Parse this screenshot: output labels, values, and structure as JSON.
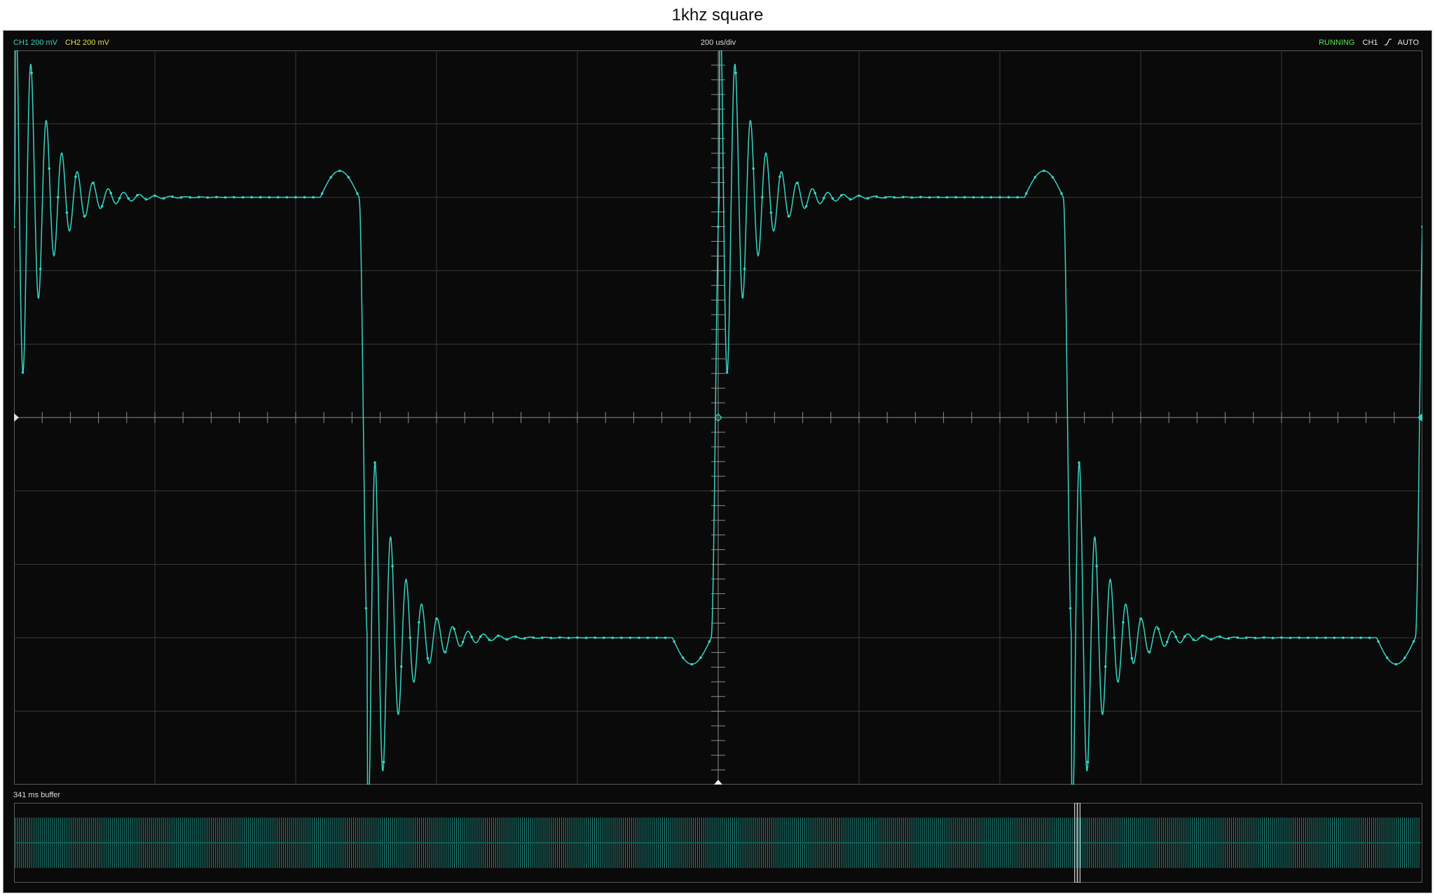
{
  "title": "1khz square",
  "status": {
    "ch1": "CH1 200 mV",
    "ch2": "CH2 200 mV",
    "timebase": "200 us/div",
    "run_state": "RUNNING",
    "trigger_channel": "CH1",
    "trigger_mode": "AUTO"
  },
  "buffer_label": "341 ms buffer",
  "colors": {
    "ch1": "#33d6c2",
    "ch2": "#e6e04a",
    "running": "#58e35a",
    "grid": "#3a3a3a",
    "background": "#0a0a0a"
  },
  "chart_data": {
    "type": "line",
    "title": "1khz square",
    "xlabel": "",
    "ylabel": "",
    "x_divisions": 10,
    "y_divisions": 10,
    "time_per_div_us": 200,
    "volts_per_div_mv": 200,
    "xlim_us": [
      0,
      2000
    ],
    "ylim_mv": [
      -1000,
      1000
    ],
    "grid": true,
    "series": [
      {
        "name": "CH1",
        "frequency_hz": 1000,
        "high_mv": 600,
        "low_mv": -600,
        "overshoot_peak_mv": 1170,
        "undershoot_peak_mv": -1170,
        "rising_edges_us": [
          0,
          1000,
          2000
        ],
        "falling_edges_us": [
          500,
          1500
        ],
        "ringing_period_us": 22,
        "ringing_decay_us": 40
      }
    ],
    "buffer": {
      "length_ms": 341,
      "view_position": 0.755
    }
  }
}
